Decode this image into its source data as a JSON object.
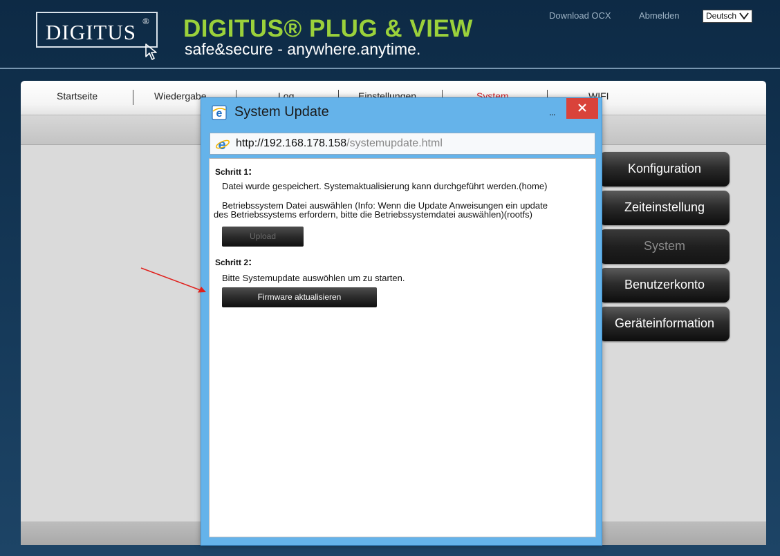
{
  "header": {
    "logo_text": "DIGITUS",
    "logo_reg": "®",
    "brand_title": "DIGITUS® PLUG & VIEW",
    "brand_subtitle": "safe&secure - anywhere.anytime.",
    "links": {
      "download_ocx": "Download OCX",
      "logout": "Abmelden"
    },
    "language": {
      "selected": "Deutsch",
      "icon": "chevron-down-icon"
    },
    "colors": {
      "brand_green": "#9bd13b",
      "background": "#0d2a45"
    }
  },
  "nav": {
    "items": [
      {
        "label": "Startseite"
      },
      {
        "label": "Wiedergabe"
      },
      {
        "label": "Log"
      },
      {
        "label": "Einstellungen"
      },
      {
        "label": "System",
        "active": true
      },
      {
        "label": "WIFI"
      }
    ],
    "active_color": "#d3222a"
  },
  "sidebar": {
    "buttons": [
      {
        "label": "Konfiguration"
      },
      {
        "label": "Zeiteinstellung"
      },
      {
        "label": "System",
        "active": true
      },
      {
        "label": "Benutzerkonto"
      },
      {
        "label": "Geräteinformation"
      }
    ]
  },
  "dialog": {
    "title": "System Update",
    "more_label": "...",
    "close_icon": "close-icon",
    "url_host": "http://192.168.178.158",
    "url_path": "/systemupdate.html",
    "step1": {
      "heading": "Schritt 1",
      "colon": ":",
      "saved_text": "Datei wurde gespeichert. Systemaktualisierung kann durchgeführt werden.(home)",
      "os_text_line1": "Betriebssystem Datei auswählen (Info: Wenn die Update Anweisungen ein update",
      "os_text_line2": "des Betriebssystems erfordern, bitte die Betriebssystemdatei auswählen)(rootfs)",
      "upload_label": "Upload"
    },
    "step2": {
      "heading": "Schritt 2",
      "colon": ":",
      "instruction": "Bitte Systemupdate auswöhlen um zu starten.",
      "firmware_button": "Firmware aktualisieren"
    },
    "colors": {
      "frame": "#65b3ea",
      "close": "#d9433a"
    }
  },
  "annotation": {
    "arrow_color": "#e0201c"
  }
}
